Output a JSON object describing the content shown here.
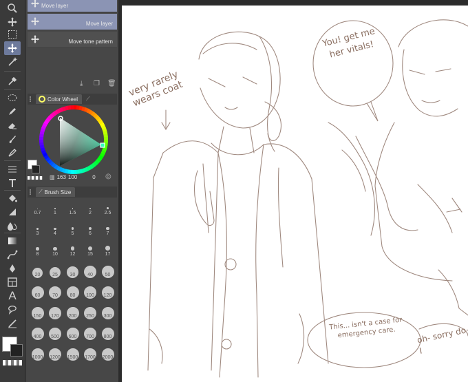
{
  "sub_tools": [
    {
      "label": "Move layer",
      "icon": "move-icon",
      "selected": true
    },
    {
      "label": "Move layer",
      "icon": "move-icon",
      "selected": true
    },
    {
      "label": "Move tone pattern",
      "icon": "move-icon",
      "selected": false
    }
  ],
  "color_wheel": {
    "tab_label": "Color Wheel",
    "h": "163",
    "s": "100",
    "v": "0",
    "main_color": "#ffffff",
    "sub_color": "#222222"
  },
  "brush_size": {
    "tab_label": "Brush Size",
    "sizes": [
      "0.7",
      "1",
      "1.5",
      "2",
      "2.5",
      "3",
      "4",
      "5",
      "6",
      "7",
      "8",
      "10",
      "12",
      "15",
      "17",
      "20",
      "25",
      "30",
      "40",
      "50",
      "60",
      "70",
      "80",
      "100",
      "120",
      "150",
      "170",
      "200",
      "250",
      "300",
      "400",
      "500",
      "600",
      "700",
      "800",
      "1000",
      "1200",
      "1500",
      "1700",
      "2000"
    ]
  },
  "canvas_notes": {
    "note1": "very rarely wears coat",
    "note2": "You! get me her vitals!",
    "note3": "This... isn't a case for emergency care.",
    "note4": "oh- sorry do- I"
  },
  "accent": "#8b94b4"
}
